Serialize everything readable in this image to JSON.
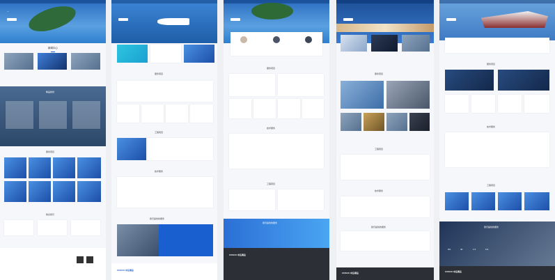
{
  "meta": {
    "accent": "#1a5fd0",
    "footer_dark": "#2c2f36"
  },
  "col1": {
    "sections": [
      "新闻中心",
      "精品航线",
      "服务项目",
      "联系我们"
    ]
  },
  "col2": {
    "sections": [
      "服务项目",
      "工程项目",
      "技术服务",
      "我们提供的服务"
    ]
  },
  "col3": {
    "sections": [
      "服务项目",
      "技术服务",
      "工程项目",
      "我们提供的服务"
    ]
  },
  "col4": {
    "sections": [
      "服务项目",
      "工程项目",
      "技术服务",
      "我们提供的服务"
    ]
  },
  "col5": {
    "sections": [
      "服务项目",
      "技术服务",
      "工程项目",
      "我们提供的服务"
    ]
  },
  "logo": "COSCO 中远海运",
  "stat_values": [
    "6%",
    "40",
    "1.5",
    "1%"
  ]
}
